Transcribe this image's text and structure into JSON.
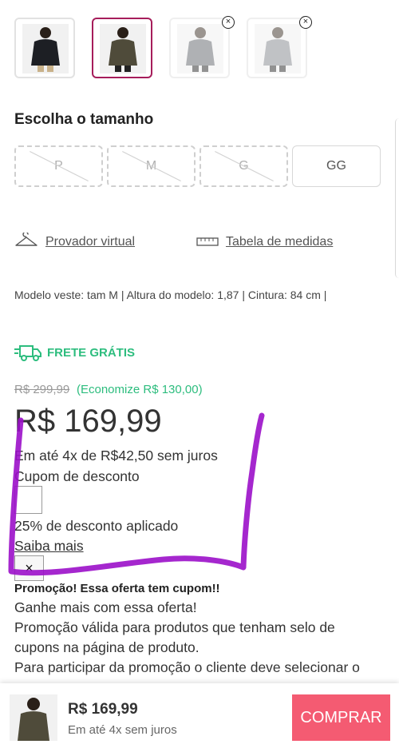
{
  "colors": {
    "accent": "#a61d5b",
    "free_shipping": "#2dbd7e",
    "savings": "#2dbd7e",
    "buy_button": "#f45b72",
    "annotation": "#9b10c9"
  },
  "color_options": [
    {
      "name": "black jacket",
      "state": "available"
    },
    {
      "name": "olive jacket",
      "state": "selected"
    },
    {
      "name": "grey jacket",
      "state": "unavailable"
    },
    {
      "name": "light grey jacket",
      "state": "unavailable"
    }
  ],
  "sizes": {
    "title": "Escolha o tamanho",
    "options": [
      {
        "label": "P",
        "available": false
      },
      {
        "label": "M",
        "available": false
      },
      {
        "label": "G",
        "available": false
      },
      {
        "label": "GG",
        "available": true
      }
    ]
  },
  "links": {
    "virtual_fitting": "Provador virtual",
    "size_chart": "Tabela de medidas"
  },
  "model_info": "Modelo veste: tam M | Altura do modelo: 1,87 | Cintura: 84 cm |",
  "shipping": {
    "label": "FRETE GRÁTIS",
    "icon": "truck-icon"
  },
  "price": {
    "old": "R$ 299,99",
    "savings": "(Economize R$ 130,00)",
    "current": "R$ 169,99",
    "installments": "Em até 4x de R$42,50 sem juros"
  },
  "coupon": {
    "label": "Cupom de desconto",
    "applied": "25% de desconto aplicado",
    "learn_more": "Saiba mais",
    "close": "×",
    "promo_title": "Promoção! Essa oferta tem cupom!!",
    "lines": [
      "Ganhe mais com essa oferta!",
      "Promoção válida para produtos que tenham selo de",
      "cupons na página de produto.",
      "Para participar da promoção o cliente deve selecionar o"
    ]
  },
  "bottom": {
    "price": "R$ 169,99",
    "installments": "Em até 4x sem juros",
    "buy": "COMPRAR"
  }
}
